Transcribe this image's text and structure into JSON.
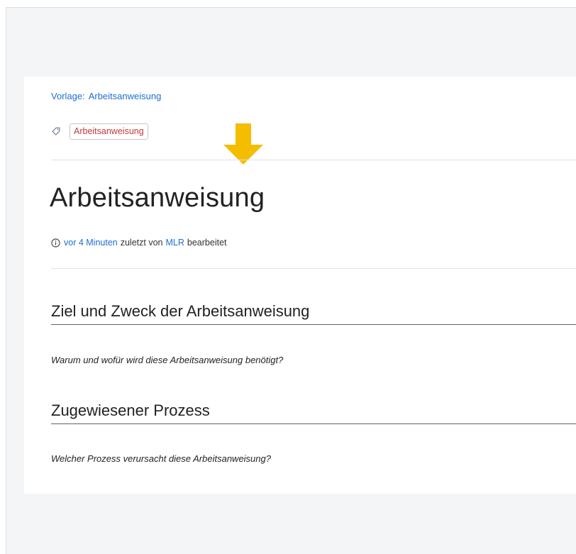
{
  "template": {
    "label": "Vorlage:",
    "link": "Arbeitsanweisung"
  },
  "labels": {
    "icon": "tag-icon",
    "items": [
      "Arbeitsanweisung"
    ]
  },
  "annotation": {
    "icon": "arrow-down-icon",
    "color": "#f5bd00"
  },
  "page": {
    "title": "Arbeitsanweisung"
  },
  "meta": {
    "icon": "info-icon",
    "time_link": "vor 4 Minuten",
    "middle_text": "zuletzt von",
    "user_link": "MLR",
    "end_text": "bearbeitet"
  },
  "sections": [
    {
      "heading": "Ziel und Zweck der Arbeitsanweisung",
      "text": "Warum und wofür wird diese Arbeitsanweisung benötigt?"
    },
    {
      "heading": "Zugewiesener Prozess",
      "text": "Welcher Prozess verursacht diese Arbeitsanweisung?"
    }
  ],
  "colors": {
    "link": "#1f6fd1",
    "label_text": "#c33a3a",
    "background": "#f4f5f7"
  }
}
